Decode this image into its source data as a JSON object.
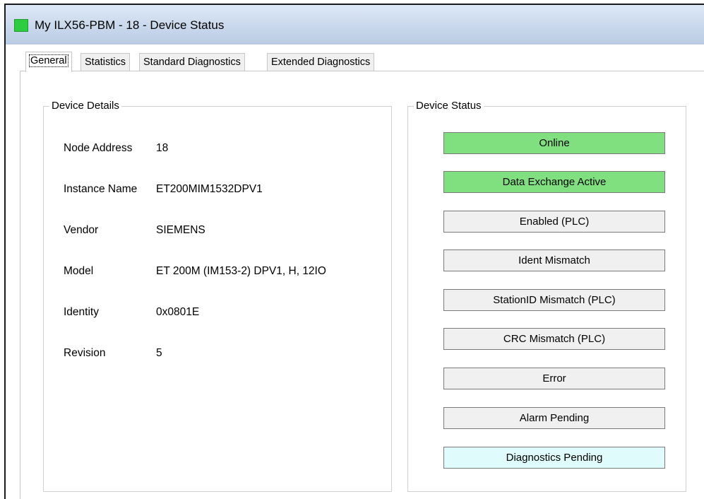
{
  "window": {
    "title": "My ILX56-PBM - 18 - Device Status"
  },
  "tabs": [
    {
      "label": "General",
      "active": true
    },
    {
      "label": "Statistics",
      "active": false
    },
    {
      "label": "Standard Diagnostics",
      "active": false
    },
    {
      "label": "Extended Diagnostics",
      "active": false
    }
  ],
  "device_details": {
    "title": "Device Details",
    "rows": [
      {
        "label": "Node Address",
        "value": "18"
      },
      {
        "label": "Instance Name",
        "value": "ET200MIM1532DPV1"
      },
      {
        "label": "Vendor",
        "value": "SIEMENS"
      },
      {
        "label": "Model",
        "value": "ET 200M (IM153-2) DPV1, H, 12IO"
      },
      {
        "label": "Identity",
        "value": "0x0801E"
      },
      {
        "label": "Revision",
        "value": "5"
      }
    ]
  },
  "device_status": {
    "title": "Device Status",
    "indicators": [
      {
        "label": "Online",
        "color": "#80e080"
      },
      {
        "label": "Data Exchange Active",
        "color": "#80e080"
      },
      {
        "label": "Enabled (PLC)",
        "color": "#f0f0f0"
      },
      {
        "label": "Ident Mismatch",
        "color": "#f0f0f0"
      },
      {
        "label": "StationID Mismatch (PLC)",
        "color": "#f0f0f0"
      },
      {
        "label": "CRC Mismatch (PLC)",
        "color": "#f0f0f0"
      },
      {
        "label": "Error",
        "color": "#f0f0f0"
      },
      {
        "label": "Alarm Pending",
        "color": "#f0f0f0"
      },
      {
        "label": "Diagnostics Pending",
        "color": "#dffbfb"
      }
    ]
  },
  "colors": {
    "title_icon": "#2ecc40",
    "active_green": "#80e080",
    "inactive_gray": "#f0f0f0",
    "pending_cyan": "#dffbfb"
  }
}
